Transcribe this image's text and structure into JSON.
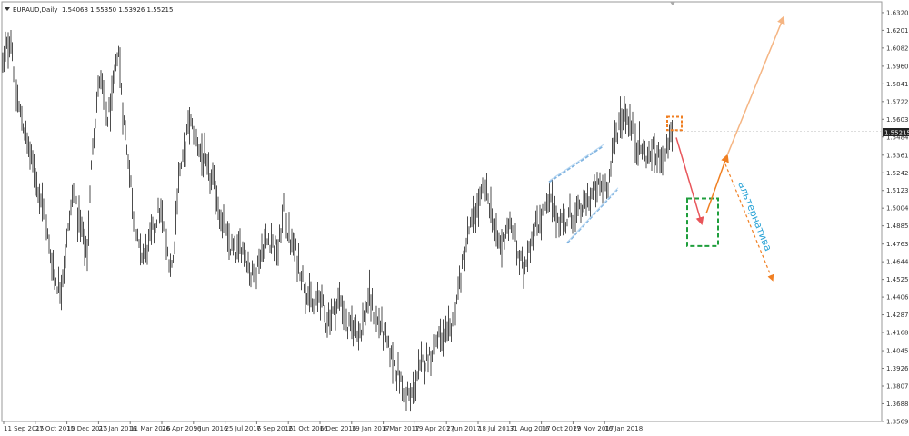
{
  "header": {
    "menu_icon": "triangle-down-icon",
    "symbol": "EURAUD,Daily",
    "ohlc": "1.54068 1.55350 1.53926 1.55215"
  },
  "annotation_label": "альтернатива",
  "colors": {
    "bars": "#4d4d4d",
    "channel": "#7fb3e0",
    "target_box": "#1f9e3c",
    "entry_box": "#f07f22",
    "down_arrow": "#e8555a",
    "up_arrow": "#f5b583",
    "alt_arrow": "#f07f22",
    "label": "#2aa3d6",
    "price_tag": "#222222"
  },
  "chart_data": {
    "type": "ohlc",
    "symbol": "EURAUD",
    "timeframe": "Daily",
    "current_price": "1.55215",
    "ylim": [
      1.3569,
      1.632
    ],
    "y_ticks": [
      "1.63205",
      "1.62015",
      "1.60825",
      "1.59600",
      "1.58410",
      "1.57220",
      "1.56030",
      "1.54840",
      "1.53615",
      "1.52425",
      "1.51235",
      "1.50045",
      "1.48855",
      "1.47630",
      "1.46440",
      "1.45250",
      "1.44060",
      "1.42870",
      "1.41680",
      "1.40455",
      "1.39265",
      "1.38075",
      "1.36885",
      "1.35695"
    ],
    "x_ticks": [
      "11 Sep 2015",
      "27 Oct 2015",
      "10 Dec 2015",
      "27 Jan 2016",
      "11 Mar 2016",
      "26 Apr 2016",
      "9 Jun 2016",
      "25 Jul 2016",
      "7 Sep 2016",
      "21 Oct 2016",
      "6 Dec 2016",
      "19 Jan 2017",
      "6 Mar 2017",
      "19 Apr 2017",
      "2 Jun 2017",
      "18 Jul 2017",
      "31 Aug 2017",
      "16 Oct 2017",
      "29 Nov 2017",
      "16 Jan 2018"
    ],
    "price_path": [
      [
        0,
        1.59
      ],
      [
        6,
        1.605
      ],
      [
        12,
        1.615
      ],
      [
        18,
        1.575
      ],
      [
        24,
        1.56
      ],
      [
        30,
        1.545
      ],
      [
        38,
        1.525
      ],
      [
        46,
        1.505
      ],
      [
        54,
        1.475
      ],
      [
        60,
        1.455
      ],
      [
        66,
        1.445
      ],
      [
        72,
        1.47
      ],
      [
        80,
        1.51
      ],
      [
        88,
        1.49
      ],
      [
        96,
        1.47
      ],
      [
        102,
        1.545
      ],
      [
        110,
        1.59
      ],
      [
        118,
        1.56
      ],
      [
        124,
        1.575
      ],
      [
        130,
        1.61
      ],
      [
        136,
        1.56
      ],
      [
        142,
        1.53
      ],
      [
        148,
        1.49
      ],
      [
        154,
        1.47
      ],
      [
        160,
        1.47
      ],
      [
        168,
        1.485
      ],
      [
        176,
        1.5
      ],
      [
        184,
        1.47
      ],
      [
        190,
        1.46
      ],
      [
        196,
        1.52
      ],
      [
        202,
        1.535
      ],
      [
        208,
        1.56
      ],
      [
        214,
        1.55
      ],
      [
        220,
        1.54
      ],
      [
        228,
        1.525
      ],
      [
        236,
        1.515
      ],
      [
        244,
        1.49
      ],
      [
        252,
        1.475
      ],
      [
        260,
        1.47
      ],
      [
        268,
        1.475
      ],
      [
        276,
        1.455
      ],
      [
        282,
        1.46
      ],
      [
        290,
        1.475
      ],
      [
        298,
        1.48
      ],
      [
        306,
        1.47
      ],
      [
        312,
        1.5
      ],
      [
        318,
        1.48
      ],
      [
        326,
        1.47
      ],
      [
        332,
        1.455
      ],
      [
        340,
        1.44
      ],
      [
        346,
        1.43
      ],
      [
        352,
        1.445
      ],
      [
        358,
        1.425
      ],
      [
        366,
        1.43
      ],
      [
        374,
        1.44
      ],
      [
        382,
        1.42
      ],
      [
        390,
        1.42
      ],
      [
        398,
        1.42
      ],
      [
        406,
        1.44
      ],
      [
        414,
        1.425
      ],
      [
        420,
        1.42
      ],
      [
        428,
        1.405
      ],
      [
        434,
        1.395
      ],
      [
        440,
        1.385
      ],
      [
        446,
        1.375
      ],
      [
        452,
        1.372
      ],
      [
        458,
        1.385
      ],
      [
        464,
        1.395
      ],
      [
        470,
        1.4
      ],
      [
        476,
        1.405
      ],
      [
        482,
        1.415
      ],
      [
        490,
        1.41
      ],
      [
        498,
        1.425
      ],
      [
        504,
        1.445
      ],
      [
        510,
        1.465
      ],
      [
        516,
        1.485
      ],
      [
        522,
        1.495
      ],
      [
        528,
        1.505
      ],
      [
        534,
        1.515
      ],
      [
        540,
        1.5
      ],
      [
        546,
        1.48
      ],
      [
        552,
        1.475
      ],
      [
        558,
        1.49
      ],
      [
        566,
        1.48
      ],
      [
        572,
        1.465
      ],
      [
        576,
        1.46
      ],
      [
        584,
        1.48
      ],
      [
        592,
        1.49
      ],
      [
        600,
        1.5
      ],
      [
        606,
        1.505
      ],
      [
        612,
        1.495
      ],
      [
        620,
        1.49
      ],
      [
        626,
        1.495
      ],
      [
        634,
        1.495
      ],
      [
        640,
        1.5
      ],
      [
        646,
        1.505
      ],
      [
        652,
        1.51
      ],
      [
        658,
        1.515
      ],
      [
        664,
        1.515
      ],
      [
        670,
        1.52
      ],
      [
        676,
        1.545
      ],
      [
        682,
        1.56
      ],
      [
        688,
        1.565
      ],
      [
        694,
        1.555
      ],
      [
        700,
        1.545
      ],
      [
        706,
        1.54
      ],
      [
        712,
        1.535
      ],
      [
        718,
        1.538
      ],
      [
        724,
        1.535
      ],
      [
        730,
        1.54
      ],
      [
        736,
        1.545
      ],
      [
        740,
        1.552
      ]
    ],
    "annotations": {
      "entry_box": {
        "x": [
          734,
          750
        ],
        "y": [
          1.553,
          1.562
        ]
      },
      "down_arrow": {
        "from": [
          744,
          1.548
        ],
        "to": [
          772,
          1.49
        ]
      },
      "target_box": {
        "x": [
          756,
          790
        ],
        "y": [
          1.475,
          1.507
        ]
      },
      "up_arrow": {
        "from": [
          777,
          1.497
        ],
        "to": [
          800,
          1.536
        ]
      },
      "long_arrow": {
        "from": [
          800,
          1.536
        ],
        "to": [
          862,
          1.629
        ]
      },
      "alt_arrow": {
        "from": [
          798,
          1.53
        ],
        "to": [
          850,
          1.452
        ]
      },
      "channel_upper": {
        "from": [
          604,
          1.518
        ],
        "to": [
          663,
          1.542
        ]
      },
      "channel_lower": {
        "from": [
          624,
          1.477
        ],
        "to": [
          679,
          1.513
        ]
      }
    }
  }
}
